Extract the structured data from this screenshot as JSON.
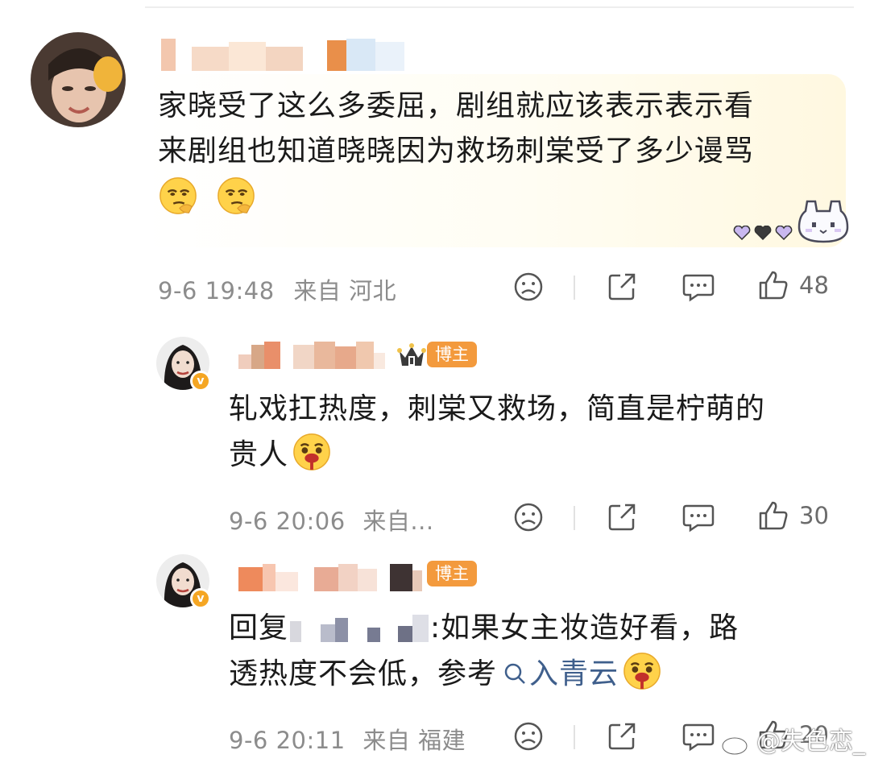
{
  "comments": [
    {
      "text_line1": "家晓受了这么多委屈，剧组就应该表示表示看",
      "text_line2": "来剧组也知道晓晓因为救场刺棠受了多少谩骂",
      "date_time": "9-6 19:48",
      "location": "来自 河北",
      "like_count": "48",
      "emoji": "smirk-hand-face"
    },
    {
      "badge": "博主",
      "text_line1": "轧戏扛热度，刺棠又救场，简直是柠萌的",
      "text_line2": "贵人",
      "date_time": "9-6 20:06",
      "location": "来自...",
      "like_count": "30",
      "emoji": "drooling-face"
    },
    {
      "badge": "博主",
      "reply_prefix": "回复",
      "reply_suffix": ":如果女主妆造好看，路",
      "text_line2_a": "透热度不会低，参考",
      "search_link": "入青云",
      "date_time": "9-6 20:11",
      "location": "来自 福建",
      "like_count": "20",
      "emoji": "drooling-face"
    }
  ],
  "verified_mark": "v",
  "watermark": "@失色恋_",
  "colors": {
    "badge_orange": "#f39a3d",
    "verified_orange": "#f5a623",
    "link_blue": "#3f5f8c",
    "meta_gray": "#8c8c8c"
  }
}
